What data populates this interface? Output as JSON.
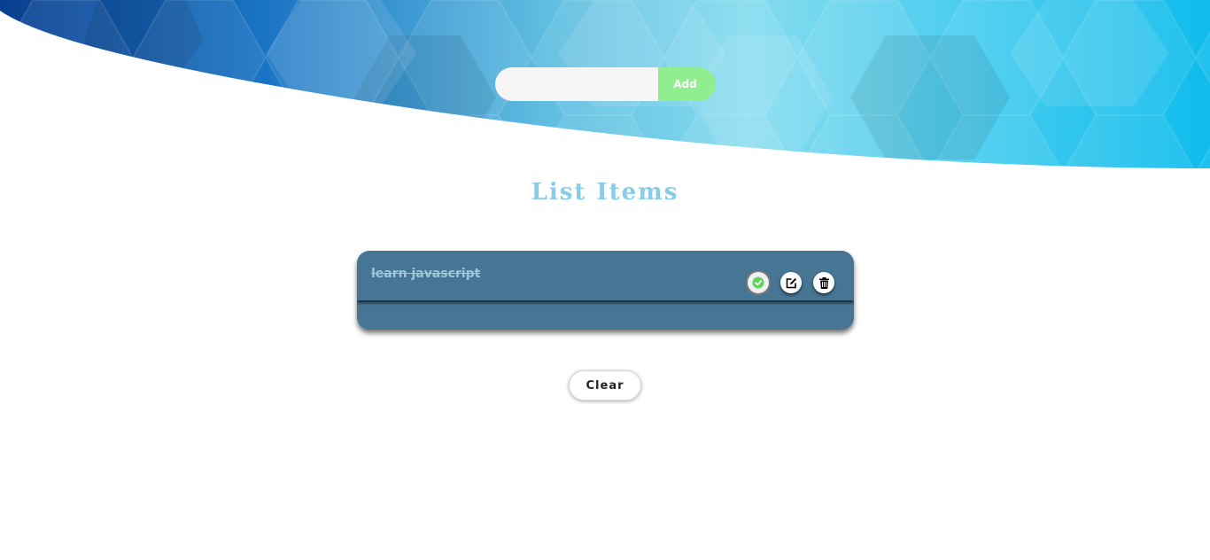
{
  "header": {
    "gradient_colors": [
      "#0a3f8f",
      "#1a74c4",
      "#7fd8ef",
      "#0fbcec"
    ]
  },
  "add_form": {
    "input_value": "",
    "input_placeholder": "",
    "add_label": "Add",
    "add_color": "#90ee90"
  },
  "list": {
    "title": "List Items",
    "title_color": "#87cdea",
    "card_color": "#467694",
    "items": [
      {
        "text": "learn javascript",
        "completed": true,
        "actions": [
          {
            "icon": "check-circle-icon",
            "color": "#5fd35f"
          },
          {
            "icon": "edit-icon",
            "color": "#000000"
          },
          {
            "icon": "trash-icon",
            "color": "#000000"
          }
        ]
      }
    ]
  },
  "clear_label": "Clear"
}
